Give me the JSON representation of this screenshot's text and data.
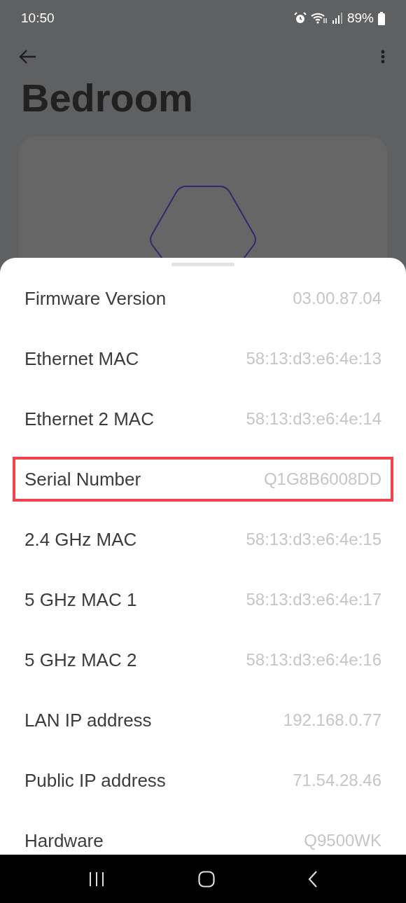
{
  "status_bar": {
    "time": "10:50",
    "battery": "89%"
  },
  "header": {
    "title": "Bedroom"
  },
  "sheet": {
    "rows": [
      {
        "label": "Firmware Version",
        "value": "03.00.87.04",
        "highlighted": false
      },
      {
        "label": "Ethernet MAC",
        "value": "58:13:d3:e6:4e:13",
        "highlighted": false
      },
      {
        "label": "Ethernet 2 MAC",
        "value": "58:13:d3:e6:4e:14",
        "highlighted": false
      },
      {
        "label": "Serial Number",
        "value": "Q1G8B6008DD",
        "highlighted": true
      },
      {
        "label": "2.4 GHz MAC",
        "value": "58:13:d3:e6:4e:15",
        "highlighted": false
      },
      {
        "label": "5 GHz MAC 1",
        "value": "58:13:d3:e6:4e:17",
        "highlighted": false
      },
      {
        "label": "5 GHz MAC 2",
        "value": "58:13:d3:e6:4e:16",
        "highlighted": false
      },
      {
        "label": "LAN IP address",
        "value": "192.168.0.77",
        "highlighted": false
      },
      {
        "label": "Public IP address",
        "value": "71.54.28.46",
        "highlighted": false
      },
      {
        "label": "Hardware",
        "value": "Q9500WK",
        "highlighted": false
      }
    ]
  }
}
